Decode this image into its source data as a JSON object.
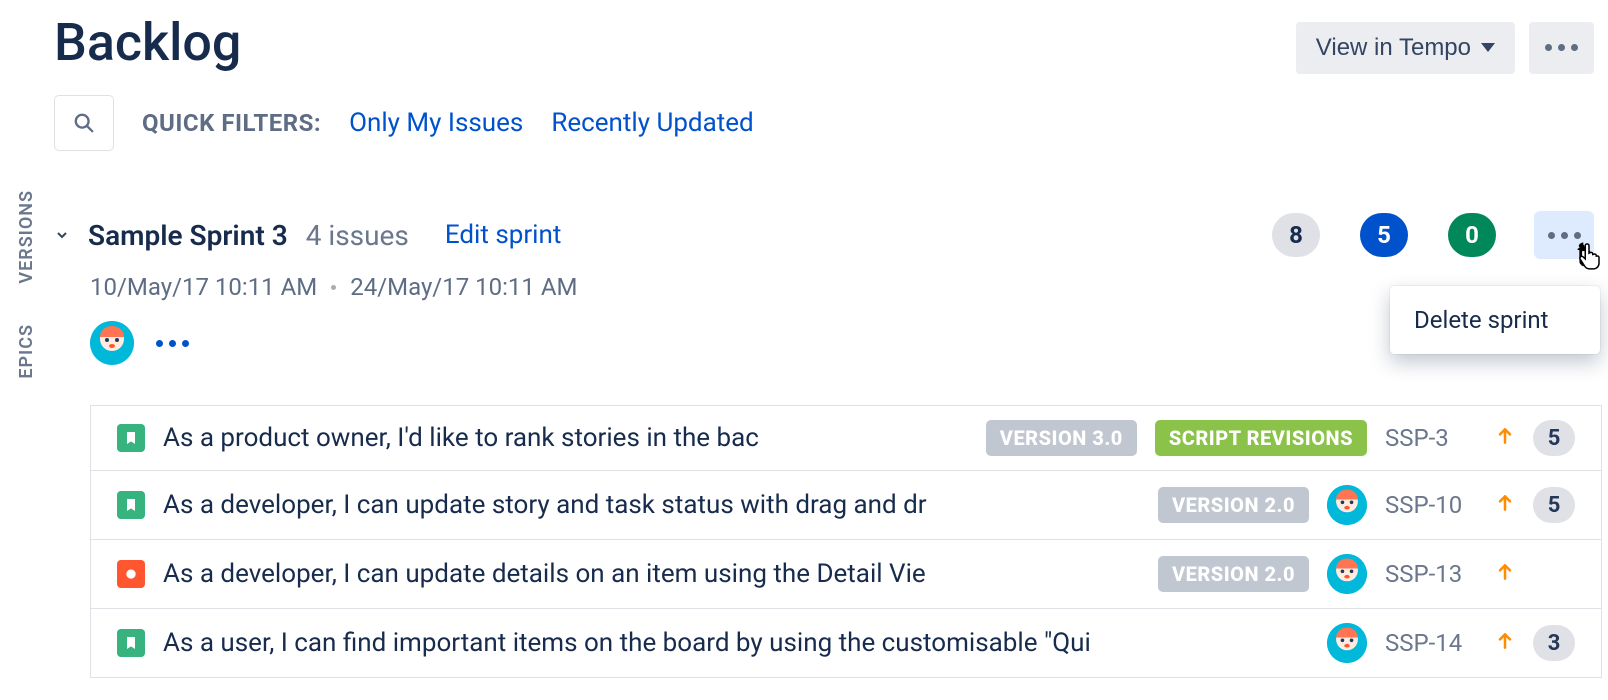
{
  "header": {
    "title": "Backlog",
    "view_button": "View in Tempo"
  },
  "side_tabs": {
    "versions": "Versions",
    "epics": "Epics"
  },
  "filters": {
    "label": "QUICK FILTERS:",
    "only_my": "Only My Issues",
    "recent": "Recently Updated"
  },
  "sprint": {
    "name": "Sample Sprint 3",
    "issue_count": "4 issues",
    "edit": "Edit sprint",
    "start": "10/May/17 10:11 AM",
    "end": "24/May/17 10:11 AM",
    "badges": {
      "todo": "8",
      "inprogress": "5",
      "done": "0"
    },
    "menu": {
      "delete": "Delete sprint"
    }
  },
  "issues": [
    {
      "type": "story",
      "summary": "As a product owner, I'd like to rank stories in the bac",
      "version": "VERSION 3.0",
      "epic": "SCRIPT REVISIONS",
      "avatar": false,
      "key": "SSP-3",
      "priority": "high",
      "estimate": "5"
    },
    {
      "type": "story",
      "summary": "As a developer, I can update story and task status with drag and dr",
      "version": "VERSION 2.0",
      "epic": null,
      "avatar": true,
      "key": "SSP-10",
      "priority": "high",
      "estimate": "5"
    },
    {
      "type": "bug",
      "summary": "As a developer, I can update details on an item using the Detail Vie",
      "version": "VERSION 2.0",
      "epic": null,
      "avatar": true,
      "key": "SSP-13",
      "priority": "high",
      "estimate": null
    },
    {
      "type": "story",
      "summary": "As a user, I can find important items on the board by using the customisable \"Qui",
      "version": null,
      "epic": null,
      "avatar": true,
      "key": "SSP-14",
      "priority": "high",
      "estimate": "3"
    }
  ]
}
